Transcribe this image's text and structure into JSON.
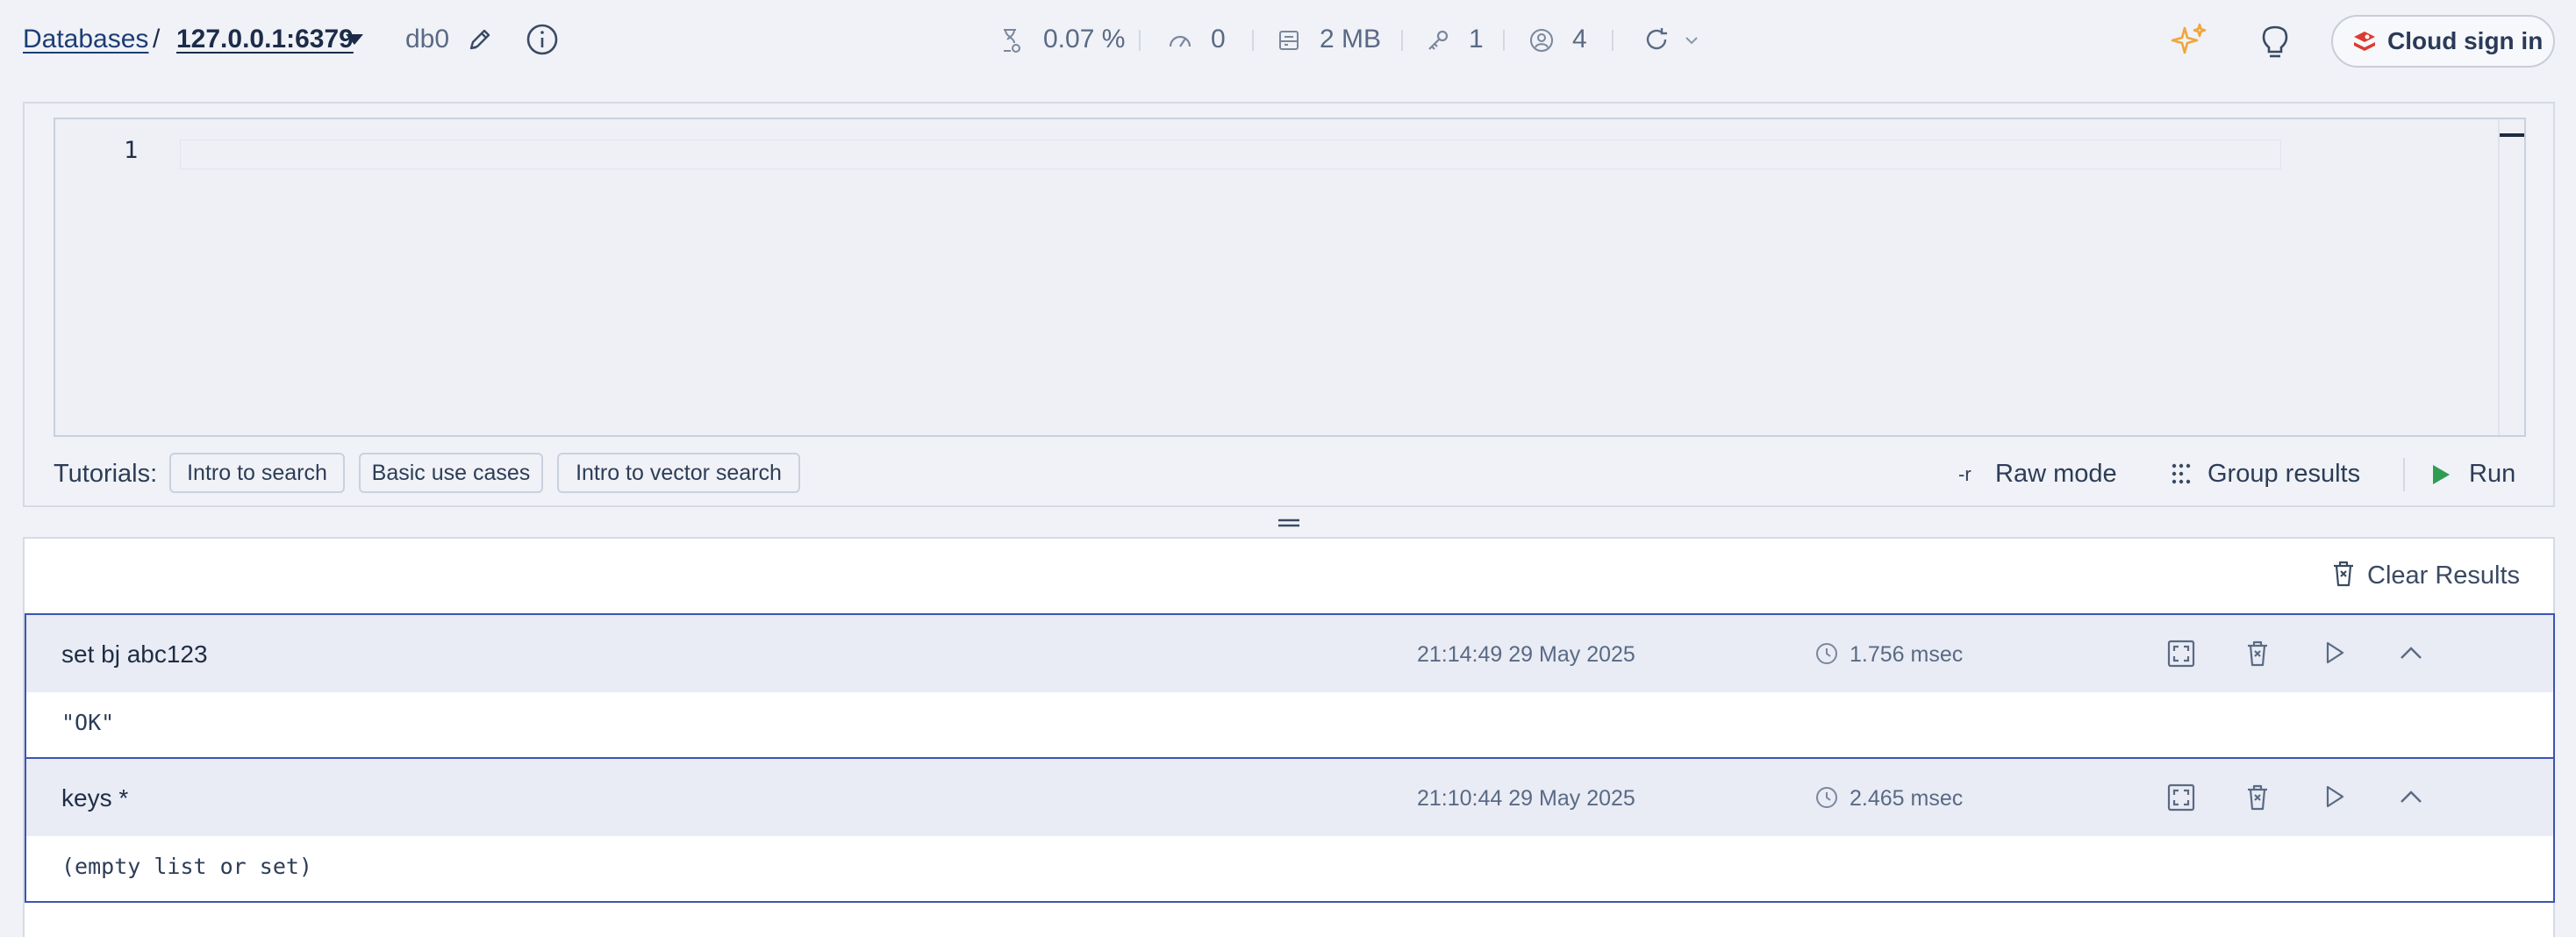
{
  "breadcrumb": {
    "databases_link": "Databases",
    "separator": "/",
    "host": "127.0.0.1:6379",
    "db_name": "db0"
  },
  "stats": {
    "cpu": "0.07 %",
    "ops": "0",
    "memory": "2 MB",
    "keys": "1",
    "clients": "4"
  },
  "header_actions": {
    "cloud_sign_in": "Cloud sign in"
  },
  "editor": {
    "line_number": "1",
    "content": ""
  },
  "tutorials": {
    "label": "Tutorials:",
    "items": [
      "Intro to search",
      "Basic use cases",
      "Intro to vector search"
    ]
  },
  "toolbar": {
    "raw_mode_prefix": "-r",
    "raw_mode": "Raw mode",
    "group_results": "Group results",
    "run": "Run"
  },
  "results": {
    "clear_label": "Clear Results",
    "items": [
      {
        "command": "set bj abc123",
        "timestamp": "21:14:49 29 May 2025",
        "duration": "1.756 msec",
        "output": "\"OK\""
      },
      {
        "command": "keys *",
        "timestamp": "21:10:44 29 May 2025",
        "duration": "2.465 msec",
        "output": "(empty list or set)"
      }
    ]
  },
  "icons": {
    "sparkle_color": "#f0a63c",
    "cloud_logo_color": "#dc3b2f",
    "run_color": "#2e9d4f",
    "result_border_color": "#3b55b0"
  }
}
